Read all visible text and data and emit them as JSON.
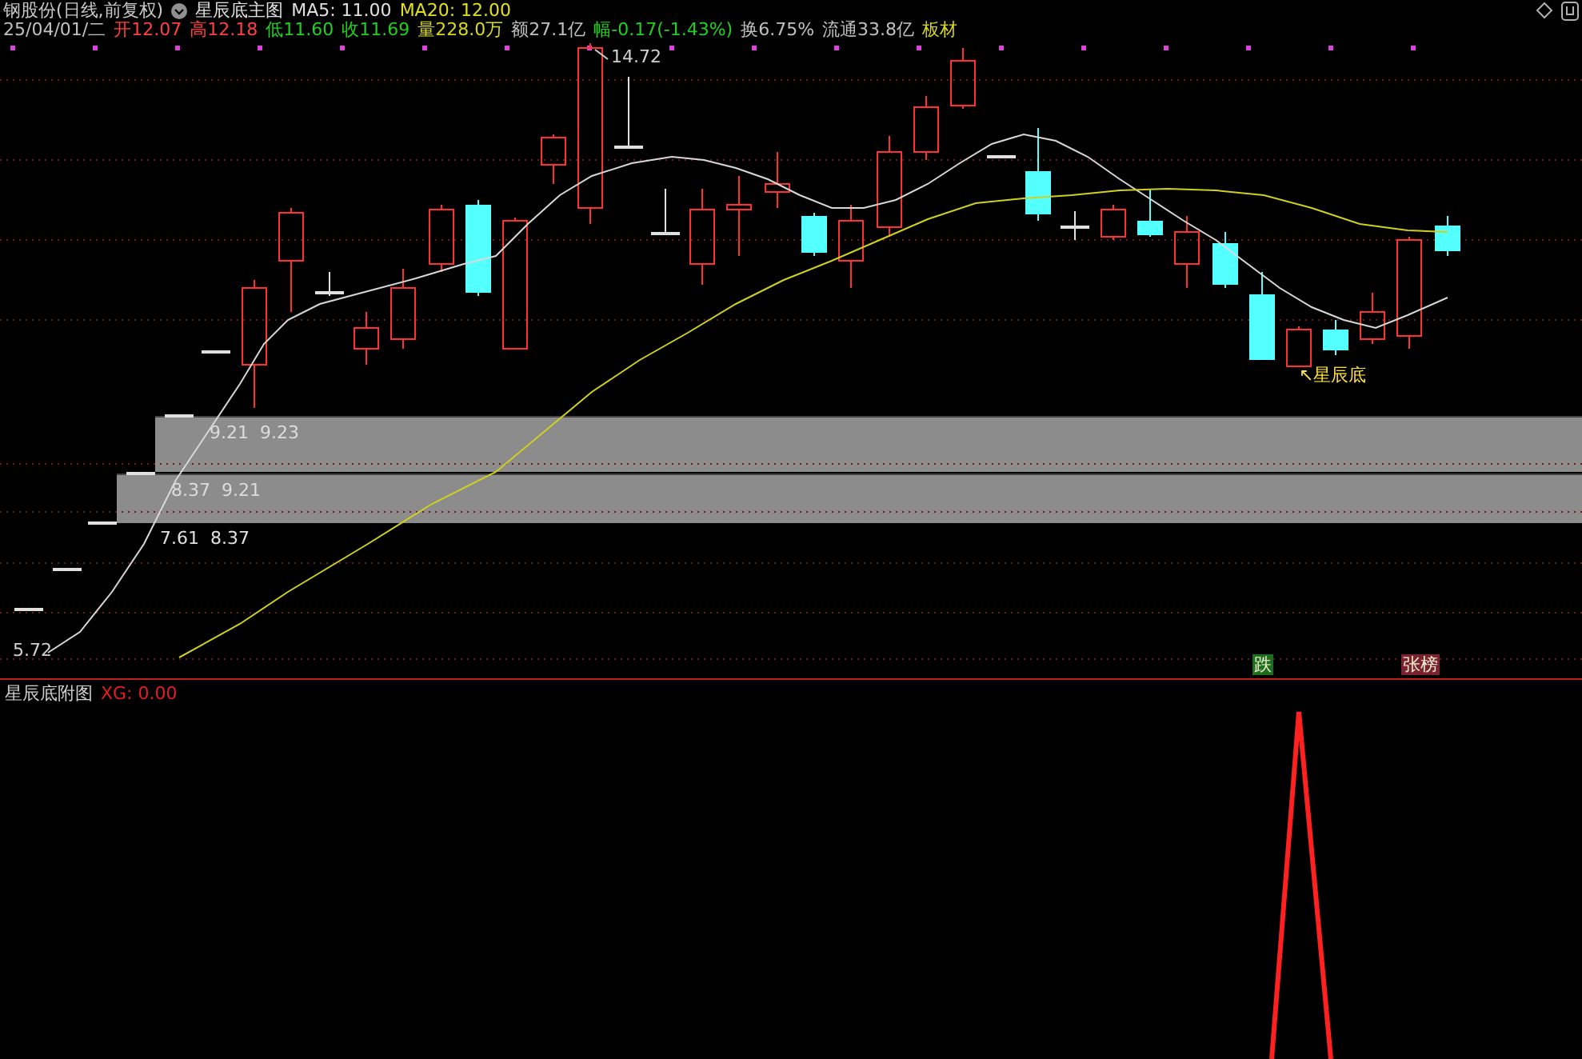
{
  "header": {
    "instrument": "钢股份(日线,前复权)",
    "indicator": "星辰底主图",
    "ma5": "MA5: 11.00",
    "ma20": "MA20: 12.00"
  },
  "quote": [
    {
      "text": "25/04/01/二",
      "color": "#c0c0c0"
    },
    {
      "text": "开12.07",
      "color": "#ff4040"
    },
    {
      "text": "高12.18",
      "color": "#ff4040"
    },
    {
      "text": "低11.60",
      "color": "#20d020"
    },
    {
      "text": "收11.69",
      "color": "#20d020"
    },
    {
      "text": "量228.0万",
      "color": "#d8d820"
    },
    {
      "text": "额27.1亿",
      "color": "#c0c0c0"
    },
    {
      "text": "幅-0.17(-1.43%)",
      "color": "#20d020"
    },
    {
      "text": "换6.75%",
      "color": "#c0c0c0"
    },
    {
      "text": "流通33.8亿",
      "color": "#c0c0c0"
    },
    {
      "text": "板材",
      "color": "#d8d820"
    }
  ],
  "main_chart": {
    "peak_label": "14.72",
    "low_label": "5.72",
    "zones": [
      {
        "label": "9.21  9.23"
      },
      {
        "label": "8.37  9.21"
      }
    ],
    "zone_label_below": "7.61  8.37",
    "signal_label": "↖星辰底",
    "markers": [
      {
        "text": "跌",
        "color": "#1f6e1f"
      },
      {
        "text": "张榜",
        "color": "#7a2230"
      }
    ]
  },
  "sub_chart": {
    "title": "星辰底附图",
    "reading": "XG: 0.00"
  }
}
